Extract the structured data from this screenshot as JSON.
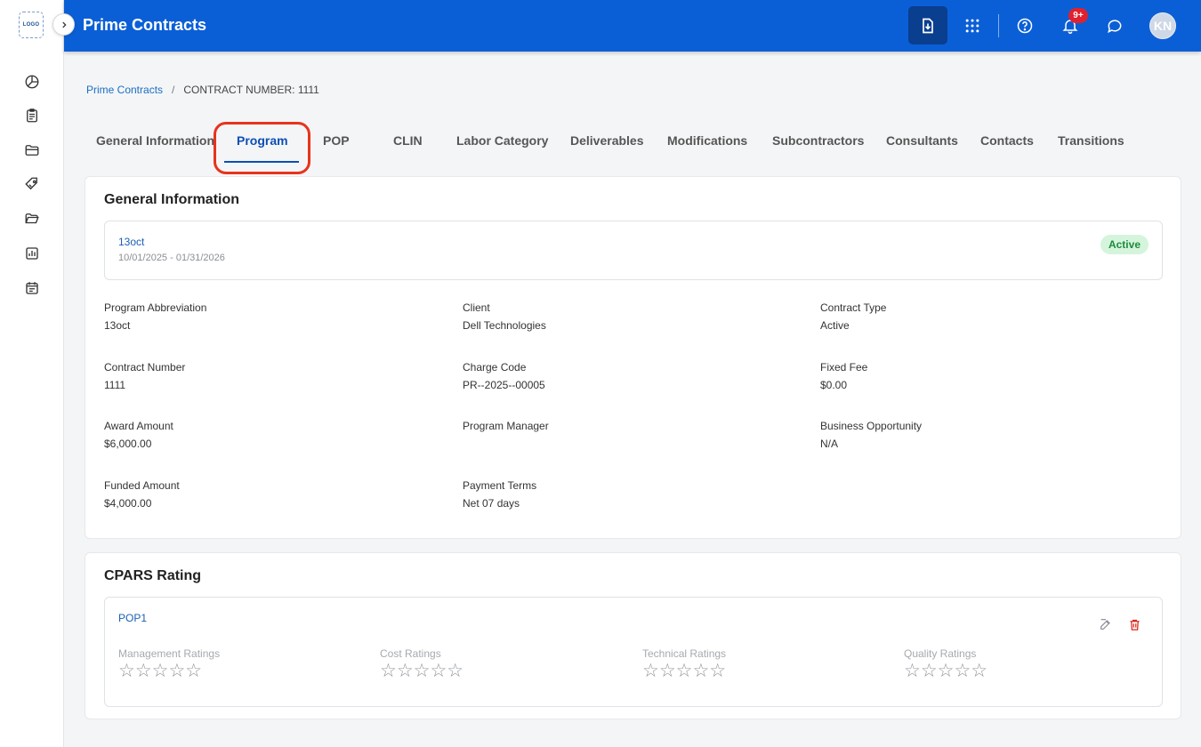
{
  "app": {
    "logo_text": "LOGO",
    "title": "Prime Contracts",
    "notifications_count": "9+",
    "user_initials": "KN"
  },
  "breadcrumb": {
    "parent": "Prime Contracts",
    "separator": "/",
    "current": "CONTRACT NUMBER: 1111"
  },
  "sidebar_icons": [
    "dashboard-icon",
    "clipboard-icon",
    "folder-icon",
    "tag-icon",
    "folder-open-icon",
    "report-icon",
    "calendar-icon"
  ],
  "tabs": [
    {
      "label": "General Information"
    },
    {
      "label": "Program"
    },
    {
      "label": "POP"
    },
    {
      "label": "CLIN"
    },
    {
      "label": "Labor Category"
    },
    {
      "label": "Deliverables"
    },
    {
      "label": "Modifications"
    },
    {
      "label": "Subcontractors"
    },
    {
      "label": "Consultants"
    },
    {
      "label": "Contacts"
    },
    {
      "label": "Transitions"
    }
  ],
  "active_tab": "Program",
  "general": {
    "title": "General Information",
    "program_name": "13oct",
    "program_dates": "10/01/2025 - 01/31/2026",
    "status": "Active",
    "fields": [
      {
        "label": "Program Abbreviation",
        "value": "13oct"
      },
      {
        "label": "Client",
        "value": "Dell Technologies"
      },
      {
        "label": "Contract Type",
        "value": "Active"
      },
      {
        "label": "Contract Number",
        "value": "1111"
      },
      {
        "label": "Charge Code",
        "value": "PR--2025--00005"
      },
      {
        "label": "Fixed Fee",
        "value": "$0.00"
      },
      {
        "label": "Award Amount",
        "value": "$6,000.00"
      },
      {
        "label": "Program Manager",
        "value": ""
      },
      {
        "label": "Business Opportunity",
        "value": "N/A"
      },
      {
        "label": "Funded Amount",
        "value": "$4,000.00"
      },
      {
        "label": "Payment Terms",
        "value": "Net 07 days"
      }
    ]
  },
  "cpars": {
    "title": "CPARS Rating",
    "pop_name": "POP1",
    "ratings": [
      {
        "label": "Management Ratings",
        "stars": 0,
        "max": 5
      },
      {
        "label": "Cost Ratings",
        "stars": 0,
        "max": 5
      },
      {
        "label": "Technical Ratings",
        "stars": 0,
        "max": 5
      },
      {
        "label": "Quality Ratings",
        "stars": 0,
        "max": 5
      }
    ],
    "colors": {
      "edit": "#8a8f96",
      "delete": "#d9261c"
    }
  },
  "colors": {
    "topbar": "#0b5fd6",
    "accent": "#0b4fb3",
    "highlight": "#e8331c",
    "status_bg": "#d4f5dc",
    "status_text": "#1e8b3c"
  }
}
